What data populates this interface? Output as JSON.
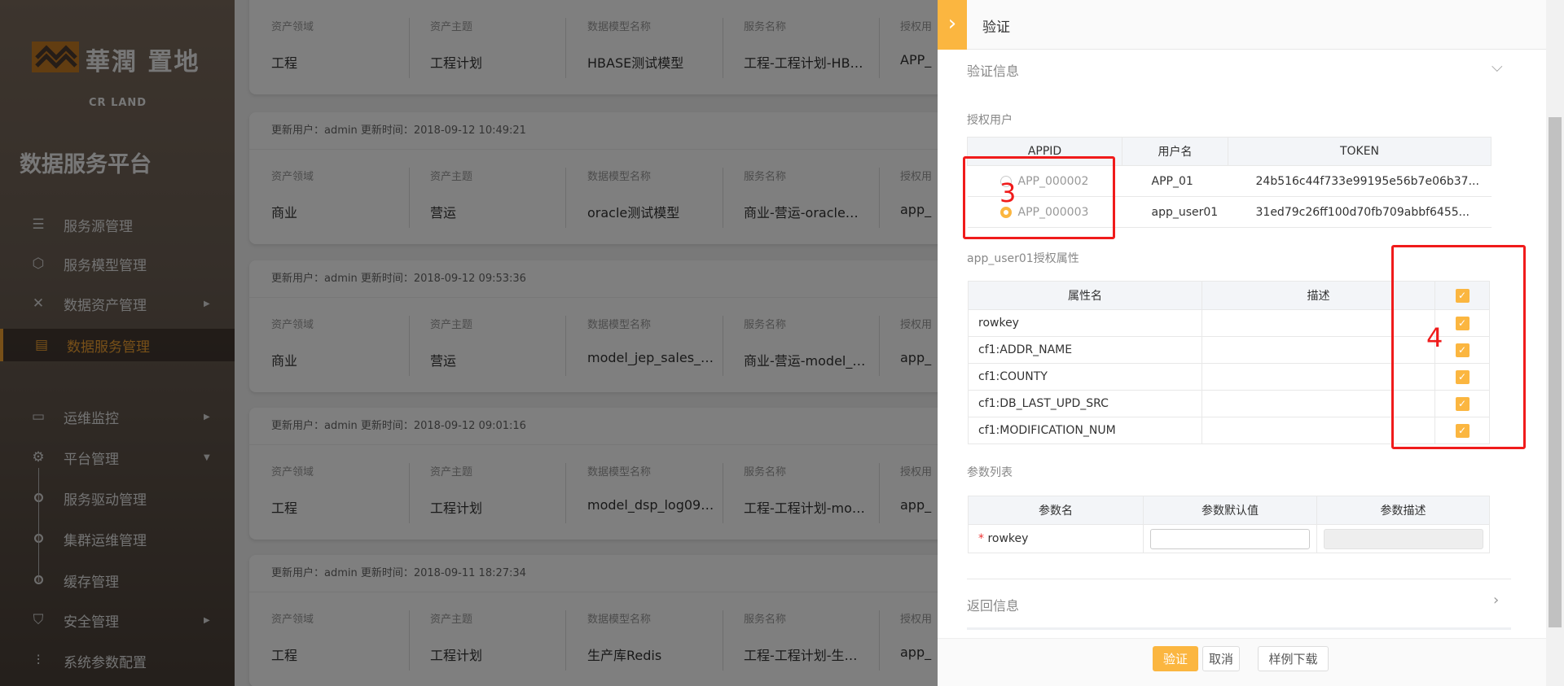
{
  "sidebar": {
    "logo_cn": "華潤 置地",
    "logo_en": "CR LAND",
    "title": "数据服务平台",
    "items": [
      {
        "label": "服务源管理",
        "icon": "database-icon"
      },
      {
        "label": "服务模型管理",
        "icon": "cube-icon"
      },
      {
        "label": "数据资产管理",
        "icon": "network-icon",
        "arrow": "▶"
      },
      {
        "label": "数据服务管理",
        "icon": "server-icon",
        "active": true
      },
      {
        "label": "运维监控",
        "icon": "monitor-icon",
        "arrow": "▶"
      },
      {
        "label": "平台管理",
        "icon": "gear-icon",
        "arrow": "▼"
      },
      {
        "label": "服务驱动管理"
      },
      {
        "label": "集群运维管理"
      },
      {
        "label": "缓存管理"
      },
      {
        "label": "安全管理",
        "icon": "shield-icon",
        "arrow": "▶"
      },
      {
        "label": "系统参数配置",
        "icon": "sliders-icon"
      }
    ]
  },
  "cards": {
    "labels": [
      "资产领域",
      "资产主题",
      "数据模型名称",
      "服务名称",
      "授权用"
    ],
    "items": [
      {
        "header": "",
        "values": [
          "工程",
          "工程计划",
          "HBASE测试模型",
          "工程-工程计划-HB…",
          "APP_"
        ]
      },
      {
        "header": "更新用户：admin 更新时间：2018-09-12 10:49:21",
        "values": [
          "商业",
          "营运",
          "oracle测试模型",
          "商业-营运-oracle…",
          "app_"
        ]
      },
      {
        "header": "更新用户：admin 更新时间：2018-09-12 09:53:36",
        "values": [
          "商业",
          "营运",
          "model_jep_sales_…",
          "商业-营运-model_…",
          "app_"
        ]
      },
      {
        "header": "更新用户：admin 更新时间：2018-09-12 09:01:16",
        "values": [
          "工程",
          "工程计划",
          "model_dsp_log09…",
          "工程-工程计划-mo…",
          "app_"
        ]
      },
      {
        "header": "更新用户：admin 更新时间：2018-09-11 18:27:34",
        "values": [
          "工程",
          "工程计划",
          "生产库Redis",
          "工程-工程计划-生…",
          "app_"
        ]
      }
    ]
  },
  "drawer": {
    "title": "验证",
    "section1": "验证信息",
    "auth_users_label": "授权用户",
    "users_table": {
      "headers": [
        "APPID",
        "用户名",
        "TOKEN"
      ],
      "rows": [
        {
          "appid": "APP_000002",
          "user": "APP_01",
          "token": "24b516c44f733e99195e56b7e06b37...",
          "selected": false
        },
        {
          "appid": "APP_000003",
          "user": "app_user01",
          "token": "31ed79c26ff100d70fb709abbf6455...",
          "selected": true
        }
      ]
    },
    "attr_label": "app_user01授权属性",
    "attr_table": {
      "headers": [
        "属性名",
        "描述"
      ],
      "rows": [
        {
          "name": "rowkey",
          "desc": "",
          "checked": true
        },
        {
          "name": "cf1:ADDR_NAME",
          "desc": "",
          "checked": true
        },
        {
          "name": "cf1:COUNTY",
          "desc": "",
          "checked": true
        },
        {
          "name": "cf1:DB_LAST_UPD_SRC",
          "desc": "",
          "checked": true
        },
        {
          "name": "cf1:MODIFICATION_NUM",
          "desc": "",
          "checked": true
        }
      ]
    },
    "param_label": "参数列表",
    "param_table": {
      "headers": [
        "参数名",
        "参数默认值",
        "参数描述"
      ],
      "rows": [
        {
          "name": "rowkey",
          "required": "*",
          "default": "",
          "desc": ""
        }
      ]
    },
    "section2": "返回信息",
    "buttons": {
      "verify": "验证",
      "cancel": "取消",
      "sample": "样例下载"
    },
    "annotations": [
      "3",
      "4"
    ],
    "accent": "#fbb640"
  }
}
